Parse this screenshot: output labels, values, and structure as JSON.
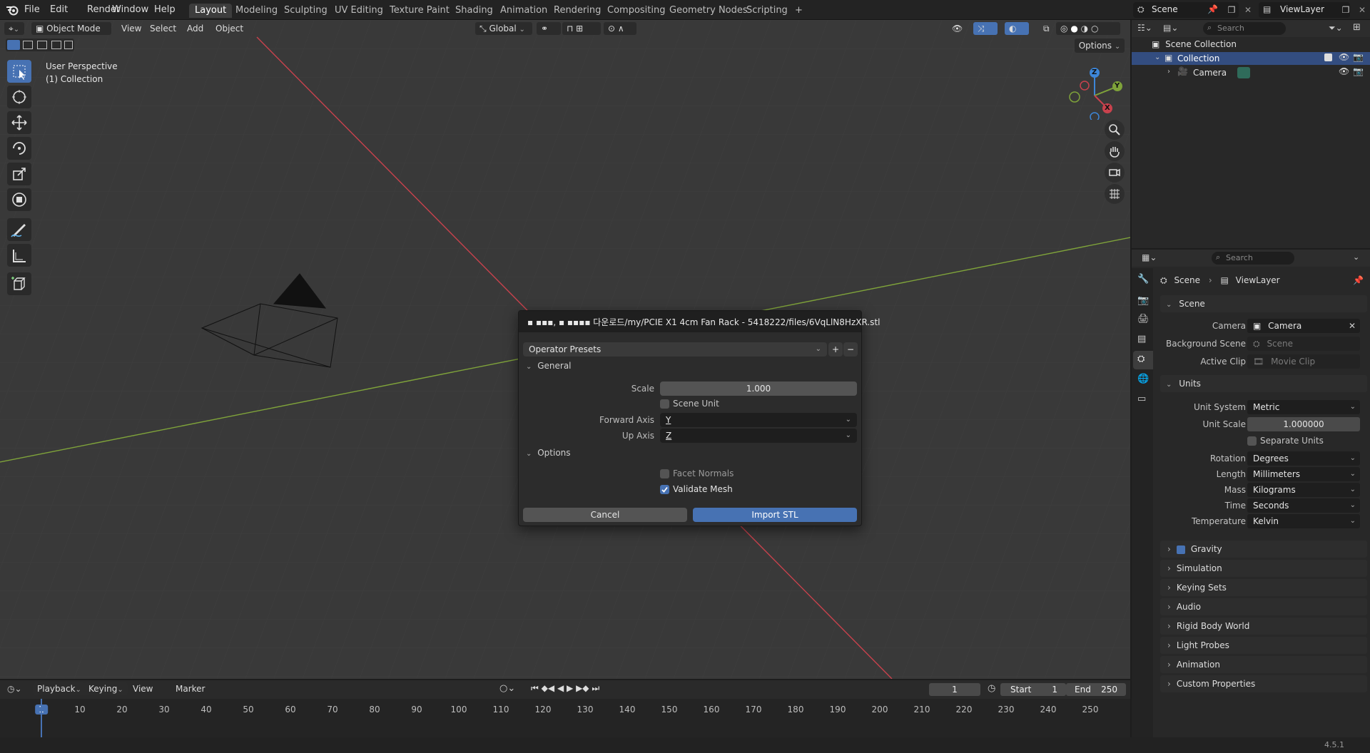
{
  "app": {
    "menus": [
      "File",
      "Edit",
      "Render",
      "Window",
      "Help"
    ],
    "workspaces": [
      "Layout",
      "Modeling",
      "Sculpting",
      "UV Editing",
      "Texture Paint",
      "Shading",
      "Animation",
      "Rendering",
      "Compositing",
      "Geometry Nodes",
      "Scripting"
    ],
    "add_workspace": "+",
    "scene_name": "Scene",
    "view_layer_name": "ViewLayer"
  },
  "viewport": {
    "mode": "Object Mode",
    "menus": [
      "View",
      "Select",
      "Add",
      "Object"
    ],
    "transform_orientation": "Global",
    "options_label": "Options",
    "overlay_line1": "User Perspective",
    "overlay_line2": "(1) Collection",
    "gizmo_labels": {
      "z": "Z",
      "y": "Y",
      "x": "X"
    }
  },
  "dialog": {
    "title": "▪ ▪▪▪,  ▪ ▪▪▪▪ 다운로드/my/PCIE X1 4cm Fan Rack - 5418222/files/6VqLlN8HzXR.stl",
    "presets_label": "Operator Presets",
    "plus": "+",
    "minus": "−",
    "general_label": "General",
    "scale_label": "Scale",
    "scale_value": "1.000",
    "scene_unit_label": "Scene Unit",
    "scene_unit_checked": false,
    "forward_axis_label": "Forward Axis",
    "forward_axis_value": "Y",
    "up_axis_label": "Up Axis",
    "up_axis_value": "Z",
    "options_label": "Options",
    "facet_normals_label": "Facet Normals",
    "facet_normals_checked": false,
    "validate_mesh_label": "Validate Mesh",
    "validate_mesh_checked": true,
    "cancel_label": "Cancel",
    "import_label": "Import STL"
  },
  "outliner": {
    "search_placeholder": "Search",
    "scene_collection": "Scene Collection",
    "collection": "Collection",
    "camera": "Camera"
  },
  "properties": {
    "search_placeholder": "Search",
    "breadcrumb_scene": "Scene",
    "breadcrumb_layer": "ViewLayer",
    "scene_panel": "Scene",
    "camera_label": "Camera",
    "camera_value": "Camera",
    "bg_scene_label": "Background Scene",
    "bg_scene_value": "Scene",
    "active_clip_label": "Active Clip",
    "active_clip_value": "Movie Clip",
    "units_panel": "Units",
    "unit_system_label": "Unit System",
    "unit_system_value": "Metric",
    "unit_scale_label": "Unit Scale",
    "unit_scale_value": "1.000000",
    "separate_units_label": "Separate Units",
    "rotation_label": "Rotation",
    "rotation_value": "Degrees",
    "length_label": "Length",
    "length_value": "Millimeters",
    "mass_label": "Mass",
    "mass_value": "Kilograms",
    "time_label": "Time",
    "time_value": "Seconds",
    "temperature_label": "Temperature",
    "temperature_value": "Kelvin",
    "collapsed_panels": [
      "Gravity",
      "Simulation",
      "Keying Sets",
      "Audio",
      "Rigid Body World",
      "Light Probes",
      "Animation",
      "Custom Properties"
    ]
  },
  "timeline": {
    "menus": [
      "Playback",
      "Keying",
      "View",
      "Marker"
    ],
    "current_frame": "1",
    "start_label": "Start",
    "start_value": "1",
    "end_label": "End",
    "end_value": "250",
    "frame_marks": [
      "1",
      "10",
      "20",
      "30",
      "40",
      "50",
      "60",
      "70",
      "80",
      "90",
      "100",
      "110",
      "120",
      "130",
      "140",
      "150",
      "160",
      "170",
      "180",
      "190",
      "200",
      "210",
      "220",
      "230",
      "240",
      "250"
    ]
  },
  "status": {
    "version": "4.5.1"
  },
  "colors": {
    "accent": "#4772b3",
    "x_axis": "#c9424d",
    "y_axis": "#7fa33a",
    "z_axis": "#3d86d8"
  }
}
